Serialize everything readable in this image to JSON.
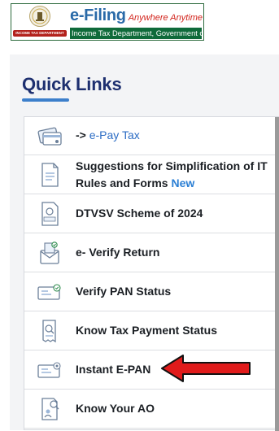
{
  "header": {
    "brand_main": "e-Filing",
    "brand_tagline": "Anywhere Anytime",
    "brand_sub": "Income Tax Department, Government of India",
    "emblem_text": "INCOME TAX DEPARTMENT"
  },
  "quick_links": {
    "title": "Quick Links",
    "items": [
      {
        "prefix": "->",
        "label": "e-Pay Tax",
        "icon": "epay-tax-icon"
      },
      {
        "label": "Suggestions for Simplification of IT Rules and Forms",
        "badge": "New",
        "icon": "document-form-icon"
      },
      {
        "label": "DTVSV Scheme of 2024",
        "icon": "dtvsv-document-icon"
      },
      {
        "label": "e- Verify Return",
        "icon": "verify-envelope-icon"
      },
      {
        "label": "Verify PAN Status",
        "icon": "pan-card-check-icon"
      },
      {
        "label": "Know Tax Payment Status",
        "icon": "receipt-search-icon"
      },
      {
        "label": "Instant E-PAN",
        "icon": "epan-card-icon"
      },
      {
        "label": "Know Your AO",
        "icon": "document-search-icon"
      }
    ]
  },
  "colors": {
    "title": "#1d2f6f",
    "accent": "#3c7fcb",
    "link": "#2b6cc4",
    "arrow": "#e01b1b",
    "brand_green": "#0f6a3a"
  }
}
